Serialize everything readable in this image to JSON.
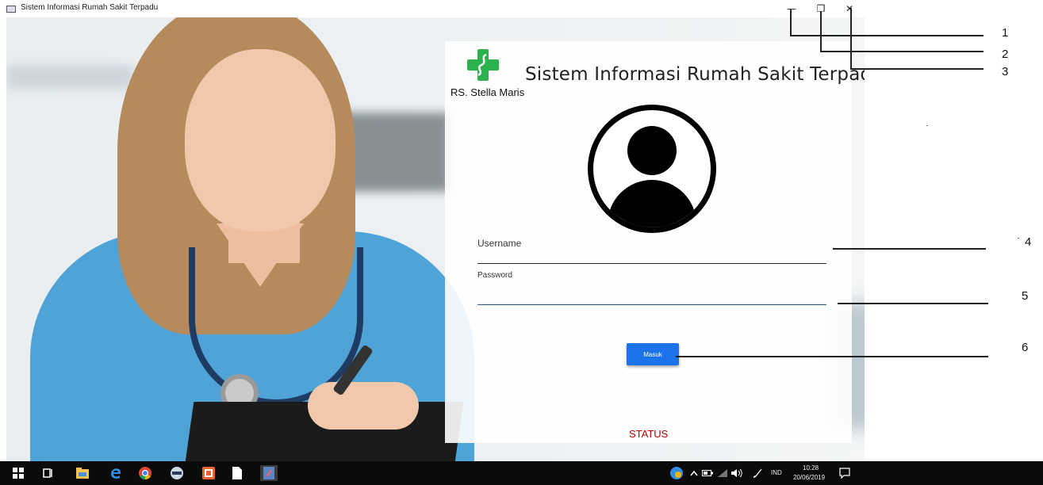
{
  "window": {
    "title": "Sistem Informasi Rumah Sakit Terpadu",
    "controls": {
      "minimize": "—",
      "maximize": "❐",
      "close": "✕"
    }
  },
  "login": {
    "hospital_name": "RS. Stella Maris",
    "app_title": "Sistem Informasi Rumah Sakit Terpadu",
    "username_label": "Username",
    "password_label": "Password",
    "username_value": "",
    "password_value": "",
    "submit_label": "Masuk",
    "status_text": "STATUS"
  },
  "callouts": [
    "1",
    "2",
    "3",
    "4",
    "5",
    "6"
  ],
  "taskbar": {
    "apps": [
      "windows-start-icon",
      "task-view-icon",
      "file-explorer-icon",
      "edge-icon",
      "chrome-icon",
      "app-icon",
      "office-icon",
      "notepad-icon",
      "java-app-icon"
    ],
    "language": "IND",
    "time": "10:28",
    "date": "20/06/2019"
  },
  "colors": {
    "logo_green": "#2bb24c",
    "button_blue": "#1a73e8",
    "status_red": "#b00000",
    "password_underline": "#2d4f8a"
  }
}
